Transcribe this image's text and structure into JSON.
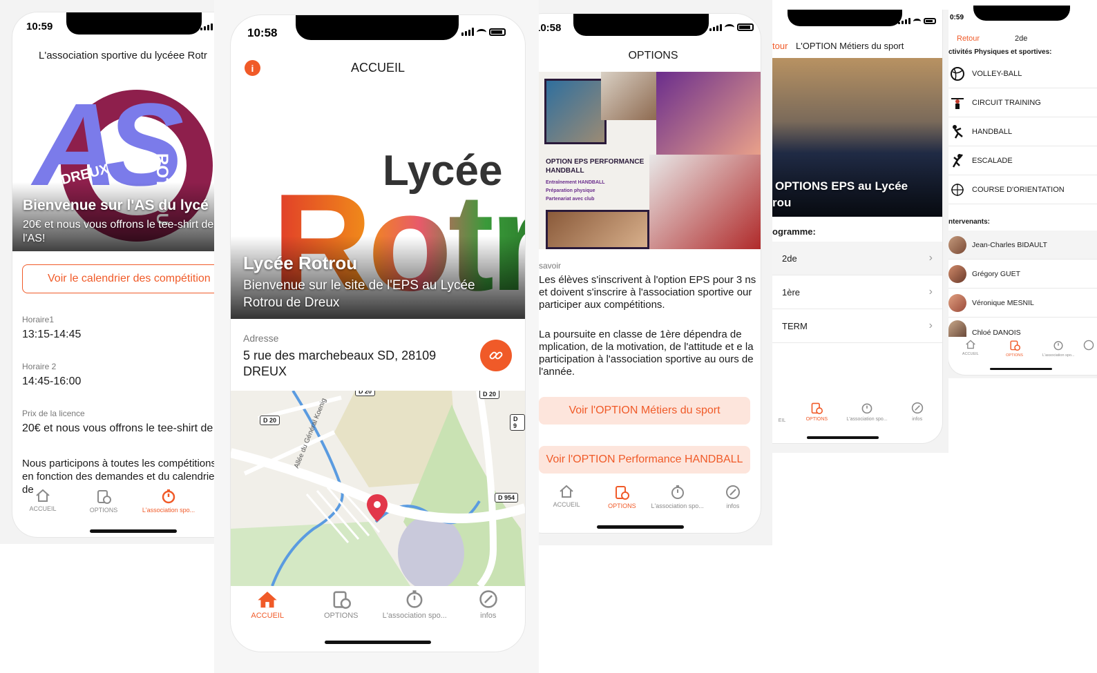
{
  "colors": {
    "accent": "#f05a28",
    "soft_button_bg": "#fde5dc",
    "tab_inactive": "#8a8a8a"
  },
  "tabs": {
    "accueil": "ACCUEIL",
    "options": "OPTIONS",
    "association": "L'association spo...",
    "infos": "infos"
  },
  "screen_as": {
    "time": "10:59",
    "title": "L'association sportive du lycéee Rotr",
    "hero_title": "Bienvenue sur l'AS du lycé",
    "hero_subtitle": "20€ et nous vous offrons le tee-shirt de l'AS!",
    "logo_letters": "AS",
    "logo_words": [
      "DREUX",
      "ROTROU"
    ],
    "calendar_button": "Voir le calendrier des compétition",
    "fields": [
      {
        "label": "Horaire1",
        "value": "13:15-14:45"
      },
      {
        "label": "Horaire 2",
        "value": "14:45-16:00"
      },
      {
        "label": "Prix de la licence",
        "value": "20€ et nous vous offrons le tee-shirt de"
      }
    ],
    "paragraph": "Nous participons à toutes les compétitions en fonction des demandes et du calendrier de"
  },
  "screen_accueil": {
    "time": "10:58",
    "header": "ACCUEIL",
    "hero_title": "Lycée Rotrou",
    "hero_subtitle": "Bienvenue sur le site de l'EPS au Lycée Rotrou de Dreux",
    "hero_logo_word": "Lycée",
    "hero_logo_big": "Rotr",
    "address_label": "Adresse",
    "address_value": "5 rue des marchebeaux SD, 28109 DREUX",
    "map_labels": [
      "D 20",
      "D 20",
      "D 20",
      "D 954",
      "Allée du Général Koenig",
      "D 9"
    ]
  },
  "screen_options": {
    "time": "10:58",
    "header": "OPTIONS",
    "poster_title": "OPTION EPS PERFORMANCE HANDBALL",
    "poster_bullets": [
      "Entraînement HANDBALL",
      "Préparation physique",
      "Partenariat avec club"
    ],
    "section_label": "savoir",
    "paragraph1": "Les élèves s'inscrivent à l'option EPS pour 3 ns et doivent s'inscrire à l'association sportive our participer aux compétitions.",
    "paragraph2": "La poursuite en classe de 1ère dépendra de mplication, de la motivation, de l'attitude et e la participation à l'association sportive au ours de l'année.",
    "button1": "Voir l'OPTION Métiers du sport",
    "button2": "Voir l'OPTION Performance HANDBALL"
  },
  "screen_metiers": {
    "back": "tour",
    "title": "L'OPTION Métiers du sport",
    "hero_title": "OPTIONS EPS au Lycée",
    "hero_title2": "rou",
    "section": "ogramme:",
    "rows": [
      "2de",
      "1ère",
      "TERM"
    ]
  },
  "screen_2de": {
    "time": "0:59",
    "back": "Retour",
    "title": "2de",
    "section1": "ctivités Physiques et sportives:",
    "activities": [
      {
        "label": "VOLLEY-BALL",
        "icon": "volleyball-icon"
      },
      {
        "label": "CIRCUIT TRAINING",
        "icon": "weightlifting-icon"
      },
      {
        "label": "HANDBALL",
        "icon": "handball-icon"
      },
      {
        "label": "ESCALADE",
        "icon": "climbing-icon"
      },
      {
        "label": "COURSE D'ORIENTATION",
        "icon": "compass-icon"
      }
    ],
    "section2": "ntervenants:",
    "people": [
      "Jean-Charles BIDAULT",
      "Grégory GUET",
      "Véronique MESNIL",
      "Chloé DANOIS"
    ]
  }
}
